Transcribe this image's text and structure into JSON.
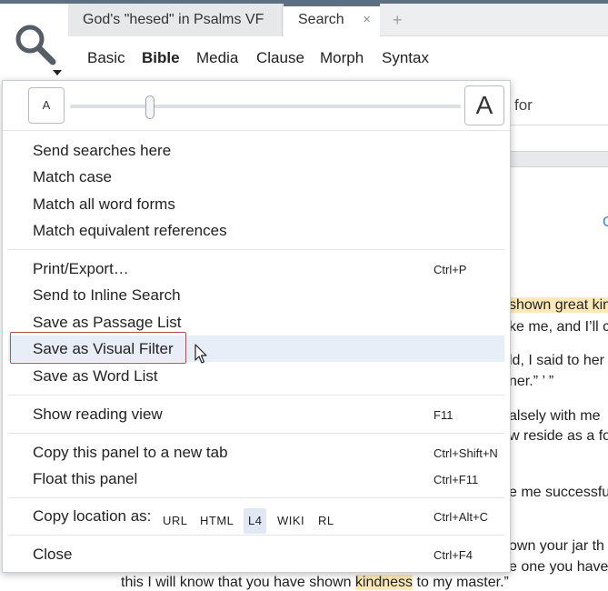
{
  "tabs": [
    {
      "label": "God's \"hesed\" in Psalms VF"
    },
    {
      "label": "Search",
      "close": "×"
    },
    {
      "label": "+"
    }
  ],
  "subtabs": [
    "Basic",
    "Bible",
    "Media",
    "Clause",
    "Morph",
    "Syntax"
  ],
  "zoom": {
    "small_label": "A",
    "large_label": "A"
  },
  "menu": {
    "group1": [
      "Send searches here",
      "Match case",
      "Match all word forms",
      "Match equivalent references"
    ],
    "print_export": {
      "label": "Print/Export…",
      "shortcut": "Ctrl+P"
    },
    "send_inline": "Send to Inline Search",
    "save_passage": "Save as Passage List",
    "save_visual": "Save as Visual Filter",
    "save_word": "Save as Word List",
    "reading_view": {
      "label": "Show reading view",
      "shortcut": "F11"
    },
    "copy_panel": {
      "label": "Copy this panel to a new tab",
      "shortcut": "Ctrl+Shift+N"
    },
    "float_panel": {
      "label": "Float this panel",
      "shortcut": "Ctrl+F11"
    },
    "copy_location": {
      "label": "Copy location as:",
      "options": [
        "URL",
        "HTML",
        "L4",
        "WIKI",
        "RL"
      ],
      "selected": "L4",
      "shortcut": "Ctrl+Alt+C"
    },
    "close": {
      "label": "Close",
      "shortcut": "Ctrl+F4"
    }
  },
  "background": {
    "for_text": "for",
    "blue_char": "C",
    "lines": [
      {
        "pre": "",
        "hl": "shown great kin",
        "post": ""
      },
      {
        "pre": "ke me, and I’ll c",
        "hl": "",
        "post": ""
      },
      {
        "pre": "ld, I said to her",
        "hl": "",
        "post": ""
      },
      {
        "pre": "ner.” ’ ”",
        "hl": "",
        "post": ""
      },
      {
        "pre": "alsely with me",
        "hl": "",
        "post": ""
      },
      {
        "pre": "w reside as a fo",
        "hl": "",
        "post": ""
      },
      {
        "pre": "e me successfu",
        "hl": "",
        "post": ""
      },
      {
        "pre": "own your jar th",
        "hl": "",
        "post": ""
      },
      {
        "pre": "e one you have",
        "hl": "",
        "post": ""
      },
      {
        "pre": "this I will know that you have shown ",
        "hl": "kindness",
        "post": " to my master.”"
      }
    ]
  },
  "colors": {
    "accent": "#5d6f82",
    "highlight": "#fde9b6",
    "hover": "#e8eef7",
    "focus_border": "#b05050"
  }
}
